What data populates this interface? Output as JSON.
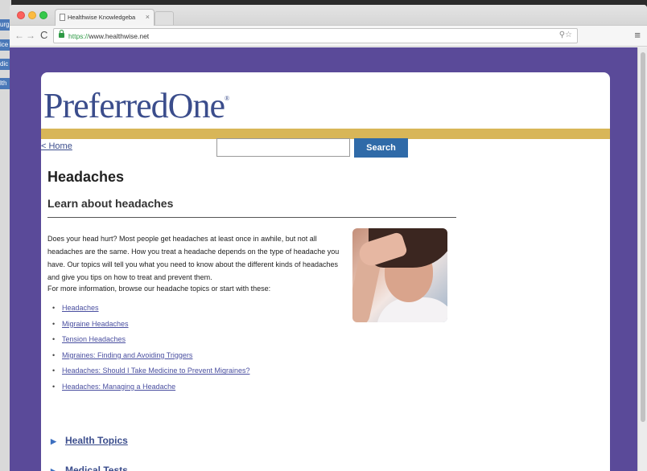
{
  "desktop": {
    "tabs": [
      "urg",
      "ice",
      "dic",
      "lth"
    ]
  },
  "browser": {
    "tab_title": "Healthwise Knowledgeba",
    "tab_close": "×",
    "url_scheme": "https://",
    "url_host": "www.healthwise.net"
  },
  "icons": {
    "back": "←",
    "forward": "→",
    "reload": "C",
    "zoom_star": "⚲☆",
    "menu": "≡"
  },
  "header": {
    "logo_text": "PreferredOne",
    "logo_reg": "®",
    "home_link": "< Home",
    "search_button": "Search",
    "search_value": ""
  },
  "content": {
    "page_title": "Headaches",
    "section_title": "Learn about headaches",
    "intro": "Does your head hurt? Most people get headaches at least once in awhile, but not all headaches are the same. How you treat a headache depends on the type of headache you have. Our topics will tell you what you need to know about the different kinds of headaches and give you tips on how to treat and prevent them.",
    "more_info": "For more information, browse our headache topics or start with these:",
    "bullet": "•",
    "topics": [
      "Headaches",
      "Migraine Headaches",
      "Tension Headaches",
      "Migraines: Finding and Avoiding Triggers",
      "Headaches: Should I Take Medicine to Prevent Migraines?",
      "Headaches: Managing a Headache"
    ]
  },
  "sections": {
    "arrow": "▶",
    "health_topics": "Health Topics",
    "medical_tests": "Medical Tests"
  }
}
